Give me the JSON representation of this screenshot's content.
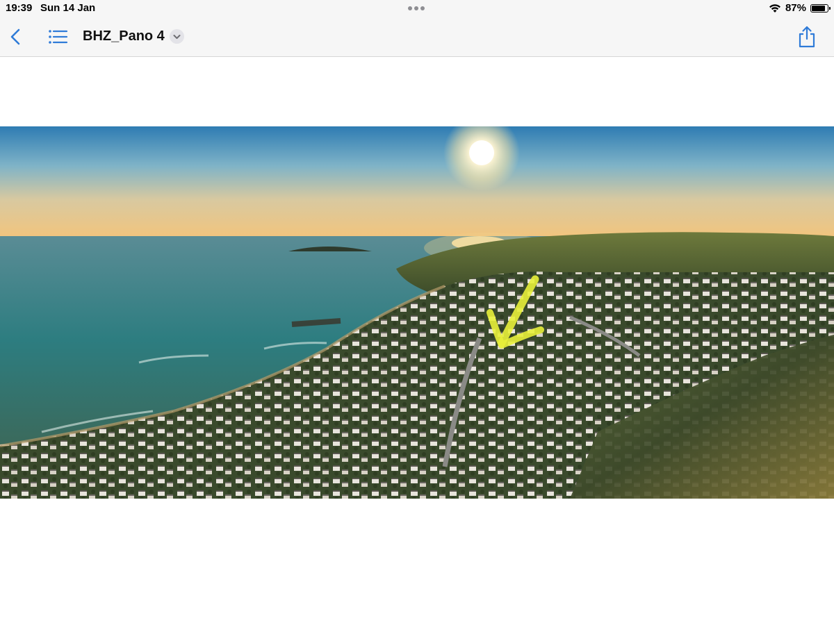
{
  "status_bar": {
    "time": "19:39",
    "date": "Sun 14 Jan",
    "battery_percent": "87%",
    "battery_level": 0.87,
    "wifi_icon": "wifi-icon",
    "battery_icon": "battery-icon"
  },
  "nav": {
    "title": "BHZ_Pano 4",
    "back_icon": "chevron-left-icon",
    "list_icon": "list-icon",
    "title_menu_icon": "chevron-down-icon",
    "share_icon": "share-icon",
    "accent_color": "#2f7bd8"
  },
  "image": {
    "description_icon": "panorama-photo",
    "annotation_color": "#e8f03a"
  }
}
